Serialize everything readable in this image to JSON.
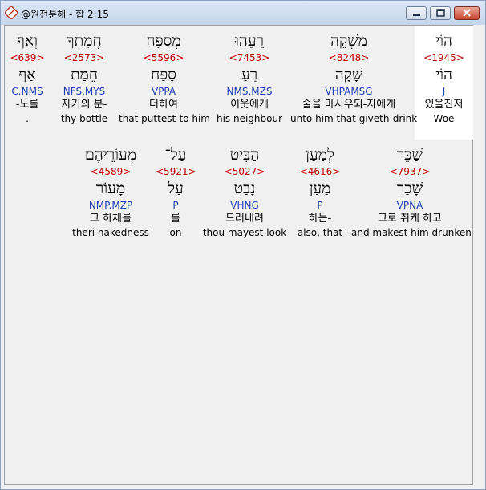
{
  "window": {
    "title": "@원전분해 - 합 2:15"
  },
  "rows": [
    [
      {
        "heb": "וְאַף",
        "strong": "<639>",
        "lex": "אַף",
        "morph": "C.NMS",
        "ko": "-노를",
        "ko2": ".",
        "en": ""
      },
      {
        "heb": "חֲמָתְךָ",
        "strong": "<2573>",
        "lex": "חֵמַת",
        "morph": "NFS.MYS",
        "ko": "자기의 분-",
        "ko2": "",
        "en": "thy bottle"
      },
      {
        "heb": "מְסַפֵּחַ",
        "strong": "<5596>",
        "lex": "סָפַח",
        "morph": "VPPA",
        "ko": "더하여",
        "ko2": "",
        "en": "that puttest-to him"
      },
      {
        "heb": "רֵעֵהוּ",
        "strong": "<7453>",
        "lex": "רֵעַ",
        "morph": "NMS.MZS",
        "ko": "이웃에게",
        "ko2": "",
        "en": "his neighbour"
      },
      {
        "heb": "מַשְׁקֵה",
        "strong": "<8248>",
        "lex": "שָׁקָה",
        "morph": "VHPAMSG",
        "ko": "술을 마시우되-자에게",
        "ko2": "",
        "en": "unto him that giveth-drink"
      },
      {
        "heb": "הוֹי",
        "strong": "<1945>",
        "lex": "הוֹי",
        "morph": "J",
        "ko": "있을진저",
        "ko2": "",
        "en": "Woe"
      }
    ],
    [
      {
        "heb": "מְעוֹרֵיהֶם׃",
        "strong": "<4589>",
        "lex": "מָעוֹר",
        "morph": "NMP.MZP",
        "ko": "그 하체를",
        "ko2": "",
        "en": "theri nakedness"
      },
      {
        "heb": "עַל־",
        "strong": "<5921>",
        "lex": "עַל",
        "morph": "P",
        "ko": "를",
        "ko2": "",
        "en": "on"
      },
      {
        "heb": "הַבִּיט",
        "strong": "<5027>",
        "lex": "נָבַט",
        "morph": "VHNG",
        "ko": "드러내려",
        "ko2": "",
        "en": "thou mayest look"
      },
      {
        "heb": "לְמַעַן",
        "strong": "<4616>",
        "lex": "מַעַן",
        "morph": "P",
        "ko": "하는-",
        "ko2": "",
        "en": "also, that"
      },
      {
        "heb": "שַׁכֵּר",
        "strong": "<7937>",
        "lex": "שָׁכַר",
        "morph": "VPNA",
        "ko": "그로 취케 하고",
        "ko2": "",
        "en": "and makest him drunken"
      }
    ]
  ]
}
